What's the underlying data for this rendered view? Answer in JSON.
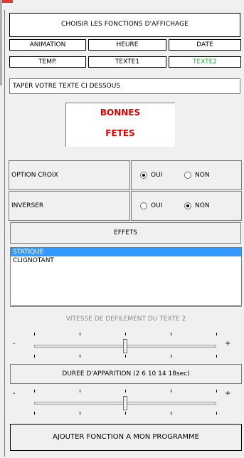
{
  "title": "CHOISIR LES FONCTIONS D'AFFICHAGE",
  "functions": [
    {
      "label": "ANIMATION",
      "active": false
    },
    {
      "label": "HEURE",
      "active": false
    },
    {
      "label": "DATE",
      "active": false
    },
    {
      "label": "TEMP.",
      "active": false
    },
    {
      "label": "TEXTE1",
      "active": false
    },
    {
      "label": "TEXTE2",
      "active": true
    }
  ],
  "instruction": "TAPER VOTRE TEXTE CI DESSOUS",
  "display": {
    "line1": "BONNES",
    "line2": "FETES",
    "color": "#e00000"
  },
  "options": {
    "croix": {
      "label": "OPTION CROIX",
      "oui": "OUI",
      "non": "NON",
      "selected": "OUI"
    },
    "inverser": {
      "label": "INVERSER",
      "oui": "OUI",
      "non": "NON",
      "selected": "NON"
    }
  },
  "effets": {
    "header": "EFFETS",
    "items": [
      "STATIQUE",
      "CLIGNOTANT"
    ],
    "selected": "STATIQUE"
  },
  "vitesse": {
    "label": "VITESSE DE DEFILEMENT DU TEXTE 2",
    "minus": "-",
    "plus": "+",
    "level": 0.5
  },
  "duree": {
    "label": "DUREE D'APPARITION (2 6 10 14 18sec)",
    "minus": "-",
    "plus": "+",
    "level": 0.5
  },
  "submit": "AJOUTER FONCTION A MON PROGRAMME",
  "colors": {
    "accent_active": "#2ea84d",
    "selection": "#3399ff",
    "display_text": "#e00000"
  }
}
